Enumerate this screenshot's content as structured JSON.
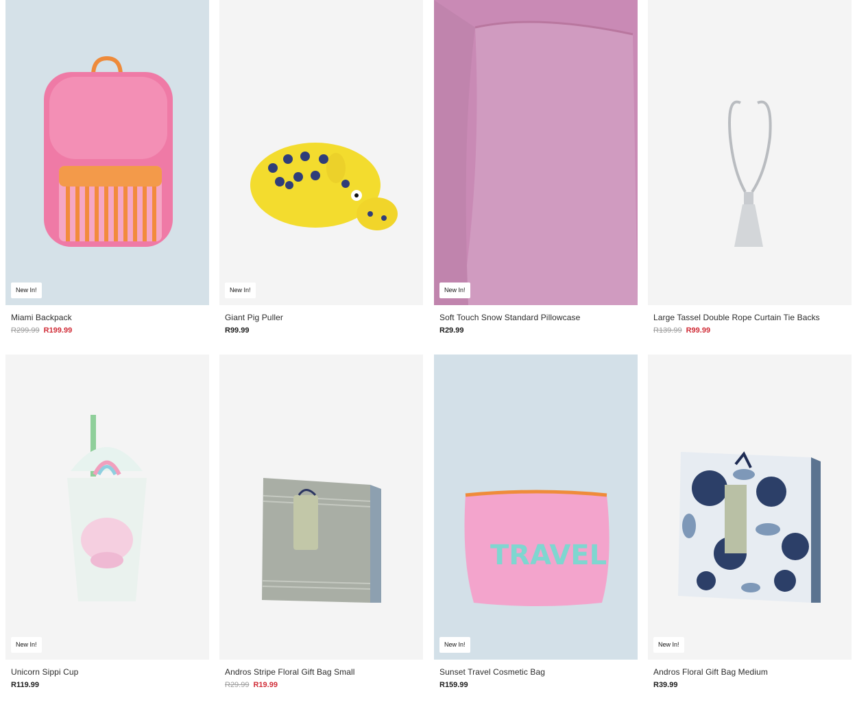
{
  "products": [
    {
      "name": "Miami Backpack",
      "badge": "New In!",
      "was": "R299.99",
      "now": "R199.99",
      "on_sale": true,
      "bg": "#d5e1e8",
      "icon": "backpack-image"
    },
    {
      "name": "Giant Pig Puller",
      "badge": "New In!",
      "was": "",
      "now": "R99.99",
      "on_sale": false,
      "bg": "#f4f4f4",
      "icon": "pig-toy-image"
    },
    {
      "name": "Soft Touch Snow Standard Pillowcase",
      "badge": "New In!",
      "was": "",
      "now": "R29.99",
      "on_sale": false,
      "bg": "#c98ab5",
      "icon": "pillowcase-image"
    },
    {
      "name": "Large Tassel Double Rope Curtain Tie Backs",
      "badge": "",
      "was": "R139.99",
      "now": "R99.99",
      "on_sale": true,
      "bg": "#f4f4f4",
      "icon": "tassel-image"
    },
    {
      "name": "Unicorn Sippi Cup",
      "badge": "New In!",
      "was": "",
      "now": "R119.99",
      "on_sale": false,
      "bg": "#f4f4f4",
      "icon": "sippi-cup-image"
    },
    {
      "name": "Andros Stripe Floral Gift Bag Small",
      "badge": "",
      "was": "R29.99",
      "now": "R19.99",
      "on_sale": true,
      "bg": "#f4f4f4",
      "icon": "gift-bag-stripe-image"
    },
    {
      "name": "Sunset Travel Cosmetic Bag",
      "badge": "New In!",
      "was": "",
      "now": "R159.99",
      "on_sale": false,
      "bg": "#d3e0e8",
      "icon": "cosmetic-bag-image"
    },
    {
      "name": "Andros Floral Gift Bag Medium",
      "badge": "New In!",
      "was": "",
      "now": "R39.99",
      "on_sale": false,
      "bg": "#f4f4f4",
      "icon": "gift-bag-floral-image"
    }
  ],
  "travel_text": "TRAVEL"
}
